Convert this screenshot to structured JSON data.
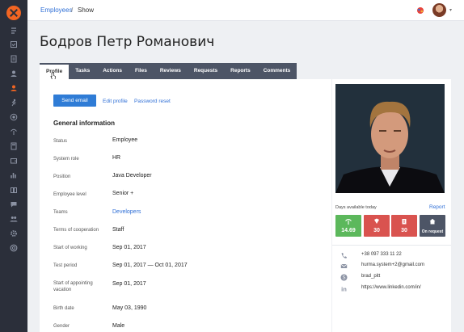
{
  "breadcrumb": {
    "parent": "Employees",
    "separator": "/",
    "current": "Show"
  },
  "page": {
    "title": "Бодров Петр Романович"
  },
  "tabs": [
    "Profile",
    "Tasks",
    "Actions",
    "Files",
    "Reviews",
    "Requests",
    "Reports",
    "Comments"
  ],
  "active_tab": "Profile",
  "actions": {
    "send_email": "Send email",
    "edit_profile": "Edit profile",
    "password_reset": "Password reset"
  },
  "general": {
    "title": "General information",
    "rows": [
      {
        "label": "Status",
        "value": "Employee"
      },
      {
        "label": "System role",
        "value": "HR"
      },
      {
        "label": "Position",
        "value": "Java Developer"
      },
      {
        "label": "Employee level",
        "value": "Senior +"
      },
      {
        "label": "Teams",
        "value": "Developers"
      },
      {
        "label": "Terms of cooperation",
        "value": "Staff"
      },
      {
        "label": "Start of working",
        "value": "Sep 01, 2017"
      },
      {
        "label": "Test period",
        "value": "Sep 01, 2017 — Oct 01, 2017"
      },
      {
        "label": "Start of appointing vacation",
        "value": "Sep 01, 2017"
      },
      {
        "label": "Birth date",
        "value": "May 03, 1990"
      },
      {
        "label": "Gender",
        "value": "Male"
      }
    ]
  },
  "days": {
    "label": "Days available today",
    "report_link": "Report",
    "tiles": [
      {
        "icon": "palm-tree-icon",
        "value": "14.69",
        "color": "#5cb85c"
      },
      {
        "icon": "medkit-icon",
        "value": "30",
        "color": "#d9534f"
      },
      {
        "icon": "clipboard-icon",
        "value": "30",
        "color": "#d9534f"
      },
      {
        "icon": "home-icon",
        "value": "On request",
        "color": "#4d5566"
      }
    ]
  },
  "contacts": [
    {
      "icon": "phone-icon",
      "value": "+38 097 333 11 22"
    },
    {
      "icon": "email-icon",
      "value": "hurma.system+2@gmail.com"
    },
    {
      "icon": "skype-icon",
      "value": "brad_pitt"
    },
    {
      "icon": "linkedin-icon",
      "value": "https://www.linkedin.com/in/"
    }
  ],
  "colors": {
    "sidebar": "#2b2f3a",
    "accent": "#f26522",
    "link": "#2f6fd6",
    "tabs_bg": "#4d5566"
  }
}
